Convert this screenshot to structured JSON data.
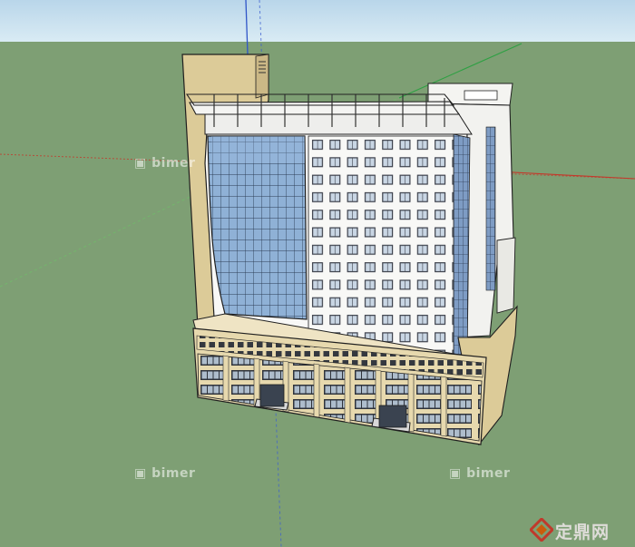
{
  "watermarks": [
    "bimer",
    "bimer",
    "bimer"
  ],
  "site_logo": {
    "text": "定鼎网"
  },
  "colors": {
    "sky": "#c9e0ee",
    "ground": "#7e9f74",
    "facade_white": "#f8f8f6",
    "podium_beige": "#e7d9ae",
    "stair_tower": "#dccb98",
    "curtain_glass": "#8fb1d6",
    "axis_red": "#c0392b",
    "axis_green": "#2ea043",
    "axis_blue": "#2f55c8"
  }
}
